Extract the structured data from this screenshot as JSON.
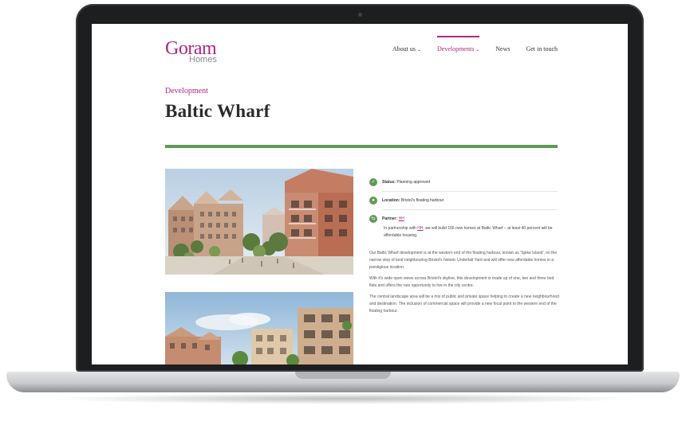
{
  "site": {
    "logo": {
      "main": "Goram",
      "sub": "Homes"
    },
    "nav": [
      {
        "label": "About us",
        "has_dropdown": true,
        "active": false
      },
      {
        "label": "Developments",
        "has_dropdown": true,
        "active": true
      },
      {
        "label": "News",
        "has_dropdown": false,
        "active": false
      },
      {
        "label": "Get in touch",
        "has_dropdown": false,
        "active": false
      }
    ]
  },
  "page": {
    "eyebrow": "Development",
    "title": "Baltic Wharf"
  },
  "facts": {
    "status": {
      "label": "Status:",
      "value": "Planning approved",
      "icon": "status-icon"
    },
    "location": {
      "label": "Location:",
      "value": "Bristol's floating harbour",
      "icon": "location-pin-icon"
    },
    "partner": {
      "label": "Partner:",
      "value": "HH",
      "icon": "handshake-icon"
    }
  },
  "intro": {
    "before": "In partnership with ",
    "link": "HH",
    "after": ", we will build 166 new homes at Baltic Wharf – at least 40 percent will be affordable housing."
  },
  "body": [
    "Our Baltic Wharf development is at the western end of the floating harbour, known as 'Spike Island', on the narrow strip of land neighbouring Bristol's historic Underfall Yard and will offer new affordable homes in a prestigious location.",
    "With it's wide open views across Bristol's skyline, this development is made up of one, two and three bed flats and offers the rare opportunity to live in the city centre.",
    "The central landscape area will be a mix of public and private space helping to create a new neighbourhood and destination. The inclusion of commercial space will provide a new focal point to the western end of the floating harbour."
  ],
  "colors": {
    "brand": "#b0267e",
    "accent": "#5f9a57",
    "text": "#2b2b2b"
  }
}
